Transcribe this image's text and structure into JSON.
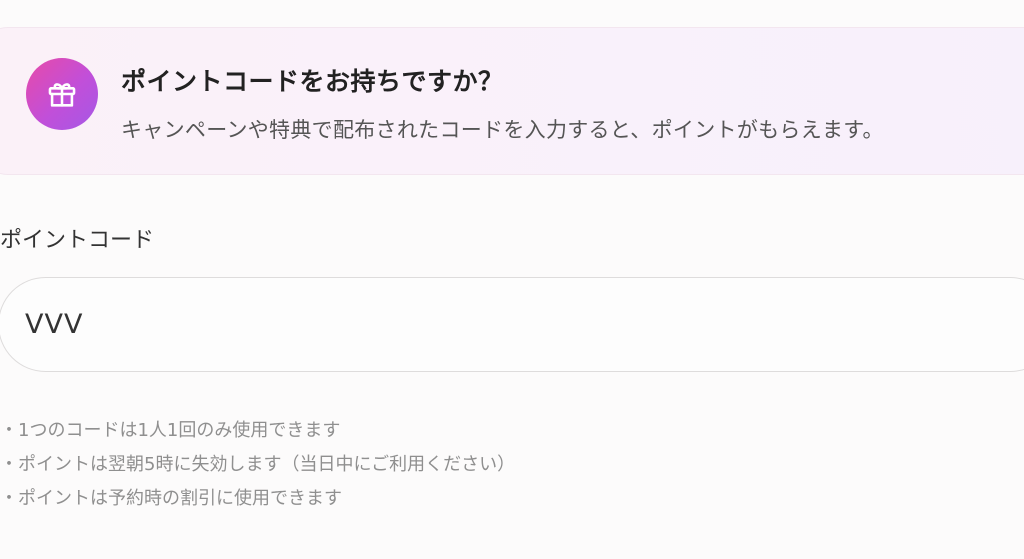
{
  "banner": {
    "icon": "gift-icon",
    "title": "ポイントコードをお持ちですか？",
    "description": "キャンペーンや特典で配布されたコードを入力すると、ポイントがもらえます。",
    "accent_start": "#e84aa8",
    "accent_end": "#a558e6"
  },
  "form": {
    "label": "ポイントコード",
    "code_value": "VVV"
  },
  "notes": [
    "・1つのコードは1人1回のみ使用できます",
    "・ポイントは翌朝5時に失効します（当日中にご利用ください）",
    "・ポイントは予約時の割引に使用できます"
  ]
}
